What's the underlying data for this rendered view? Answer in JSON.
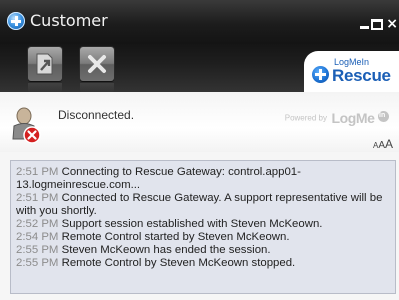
{
  "window": {
    "title": "Customer",
    "controls": {
      "minimize": "minimize",
      "maximize": "maximize",
      "close": "×"
    }
  },
  "toolbar": {
    "buttons": [
      {
        "name": "transfer-file-button",
        "icon": "document-arrow-icon"
      },
      {
        "name": "end-session-button",
        "icon": "close-x-icon"
      }
    ]
  },
  "brand": {
    "logo_small": "LogMeIn",
    "logo_big": "Rescue",
    "powered_by_prefix": "Powered by",
    "powered_by_logo": "LogMe",
    "powered_by_badge": "In"
  },
  "status": {
    "text": "Disconnected.",
    "icon": "disconnected-user-icon"
  },
  "font_size_control": {
    "small": "A",
    "medium": "A",
    "large": "A"
  },
  "log": {
    "entries": [
      {
        "time": "2:51 PM",
        "message": "Connecting to Rescue Gateway: control.app01-13.logmeinrescue.com..."
      },
      {
        "time": "2:51 PM",
        "message": "Connected to Rescue Gateway. A support representative will be with you shortly."
      },
      {
        "time": "2:52 PM",
        "message": "Support session established with Steven McKeown."
      },
      {
        "time": "2:54 PM",
        "message": "Remote Control started by Steven McKeown."
      },
      {
        "time": "2:55 PM",
        "message": "Steven McKeown has ended the session."
      },
      {
        "time": "2:55 PM",
        "message": "Remote Control by Steven McKeown stopped."
      }
    ]
  },
  "colors": {
    "titlebar": "#1c1c1c",
    "brand_blue": "#1b5fb6",
    "log_background": "#e1e4ed",
    "timestamp_gray": "#8c8c8c",
    "error_red": "#d42020"
  }
}
